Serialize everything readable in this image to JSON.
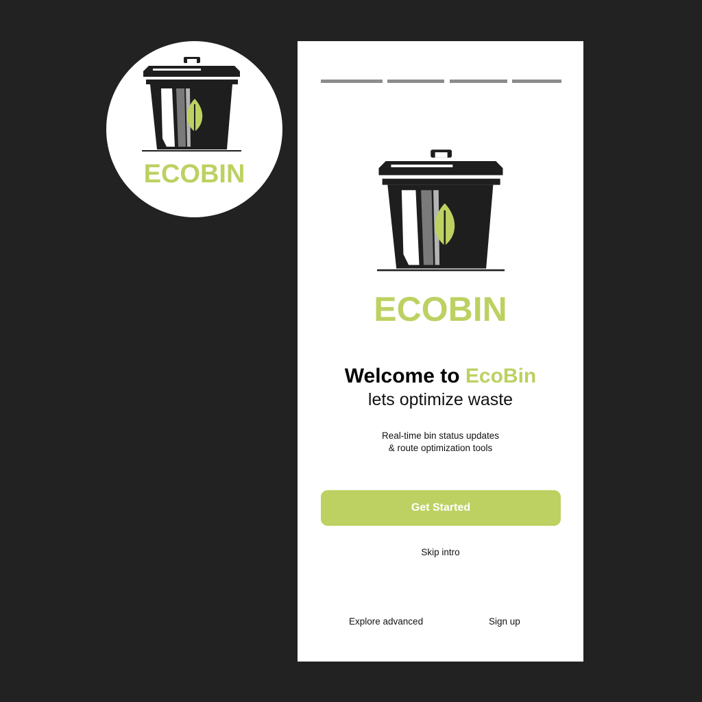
{
  "brand": {
    "logo_wordmark": "ECOBIN",
    "colors": {
      "accent": "#bcd162",
      "ink": "#1e1e1e",
      "background": "#222222",
      "screen": "#ffffff"
    }
  },
  "badge": {
    "wordmark": "ECOBIN",
    "icon": "trash-bin-leaf-icon"
  },
  "onboarding": {
    "progress_steps": 4,
    "hero_icon": "trash-bin-leaf-icon",
    "hero_wordmark": "ECOBIN",
    "welcome_prefix": "Welcome to ",
    "welcome_brand": "EcoBin",
    "tagline": "lets optimize waste",
    "description_line1": "Real-time bin status updates",
    "description_line2": "& route optimization tools",
    "primary_button": "Get Started",
    "skip_link": "Skip intro",
    "footer": {
      "explore_link": "Explore advanced",
      "signup_link": "Sign up"
    }
  }
}
